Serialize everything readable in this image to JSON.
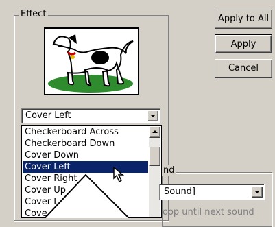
{
  "effect_group": {
    "legend": "Effect"
  },
  "sound_group": {
    "legend_fragment": "nd"
  },
  "effect_combo": {
    "value": "Cover Left"
  },
  "effect_list": {
    "items": [
      "Checkerboard Across",
      "Checkerboard Down",
      "Cover Down",
      "Cover Left",
      "Cover Right",
      "Cover Up",
      "Cover L",
      "Cove"
    ],
    "selected_index": 3
  },
  "buttons": {
    "apply_to_all": "Apply to All",
    "apply": "Apply",
    "cancel": "Cancel"
  },
  "sound_combo": {
    "value": "Sound]"
  },
  "loop_checkbox": {
    "label_fragment": "oop until next sound"
  },
  "colors": {
    "selection": "#0a246a",
    "face": "#d4d0c8"
  }
}
